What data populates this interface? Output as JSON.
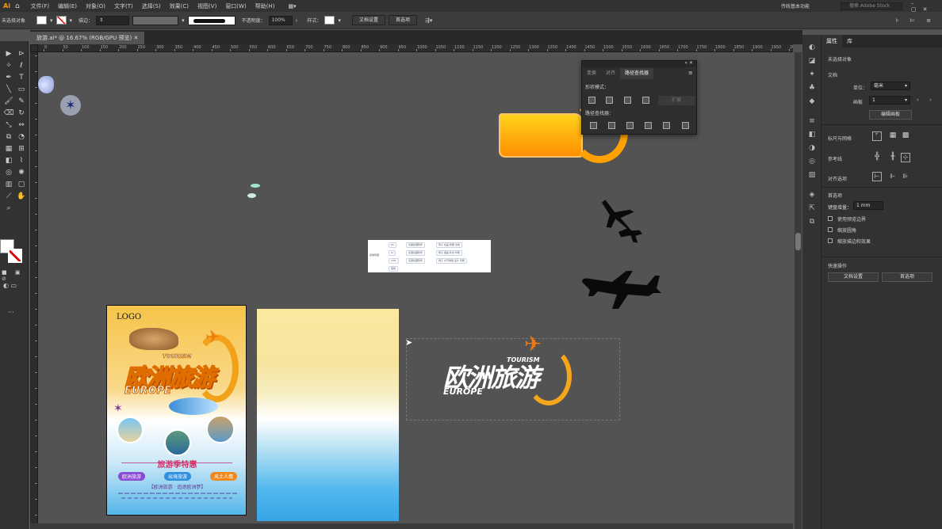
{
  "menubar": {
    "app_icon": "Ai",
    "items": [
      "文件(F)",
      "编辑(E)",
      "对象(O)",
      "文字(T)",
      "选择(S)",
      "效果(C)",
      "视图(V)",
      "窗口(W)",
      "帮助(H)"
    ],
    "workspace": "传统基本功能",
    "search_placeholder": "搜索 Adobe Stock"
  },
  "control_bar": {
    "selection_status": "未选择对象",
    "stroke_label": "描边：",
    "opacity_label": "不透明度：",
    "opacity_value": "100%",
    "style_label": "样式：",
    "doc_setup_button": "文档设置",
    "preferences_button": "首选项"
  },
  "document_tab": {
    "title": "旅游.ai* @ 16.67% (RGB/GPU 预览)"
  },
  "ruler": {
    "top_ticks": [
      "0",
      "50",
      "100",
      "150",
      "200",
      "250",
      "300",
      "350",
      "400",
      "450",
      "500",
      "550",
      "600",
      "650",
      "700",
      "750",
      "800",
      "850",
      "900",
      "950",
      "1000",
      "1050",
      "1100",
      "1150",
      "1200",
      "1250",
      "1300",
      "1350",
      "1400",
      "1450",
      "1500",
      "1550",
      "1600",
      "1650",
      "1700",
      "1750",
      "1800",
      "1850",
      "1900",
      "1950",
      "2000"
    ]
  },
  "pathfinder_panel": {
    "tabs": [
      "变换",
      "对齐",
      "路径查找器"
    ],
    "active_tab": "路径查找器",
    "shape_modes_label": "形状模式：",
    "expand_button": "扩展",
    "pathfinders_label": "路径查找器："
  },
  "properties_panel": {
    "tabs": [
      "属性",
      "库"
    ],
    "active_tab": "属性",
    "status": "未选择对象",
    "document_section": "文档",
    "units_label": "单位：",
    "units_value": "毫米",
    "artboard_label": "画板",
    "artboard_value": "1",
    "edit_artboards_button": "编辑画板",
    "rulers_grids_label": "标尺与网格",
    "guides_label": "参考线",
    "snap_label": "对齐选项",
    "preferences_section": "首选项",
    "keyboard_increment_label": "键盘增量：",
    "keyboard_increment_value": "1 mm",
    "checkboxes": [
      "使用预览边界",
      "缩放圆角",
      "缩放描边和效果"
    ],
    "quick_actions_label": "快速操作",
    "doc_setup_button": "文档设置",
    "preferences_button": "首选项"
  },
  "poster": {
    "logo_text": "LOGO",
    "tourism": "TOURISM",
    "title": "欧洲旅游",
    "subtitle": "EUROPE",
    "season_text": "旅游季特惠",
    "tags": [
      "欧洲旅游",
      "出境旅游",
      "风土人情"
    ],
    "tag_colors": [
      "#8a4bd6",
      "#2f8fe0",
      "#f08a1f"
    ],
    "slogan": "【欧洲旅游 · 追逐欧洲梦】"
  },
  "canvas_logo": {
    "tourism": "TOURISM",
    "title": "欧洲旅游",
    "subtitle": "EUROPE"
  },
  "mindmap": {
    "root": "思维导图",
    "nodes": [
      "PS",
      "AI",
      "CDR",
      "其他"
    ],
    "branches": [
      "位图处理软件",
      "矢量绘图软件",
      "矢量绘图软件",
      "例子 绘画 修图 合成",
      "例子 插画 标志 印刷",
      "例子 文字排版 设计 印刷"
    ]
  },
  "colors": {
    "accent_orange": "#ff8a00",
    "poster_magenta": "#d6336c"
  }
}
